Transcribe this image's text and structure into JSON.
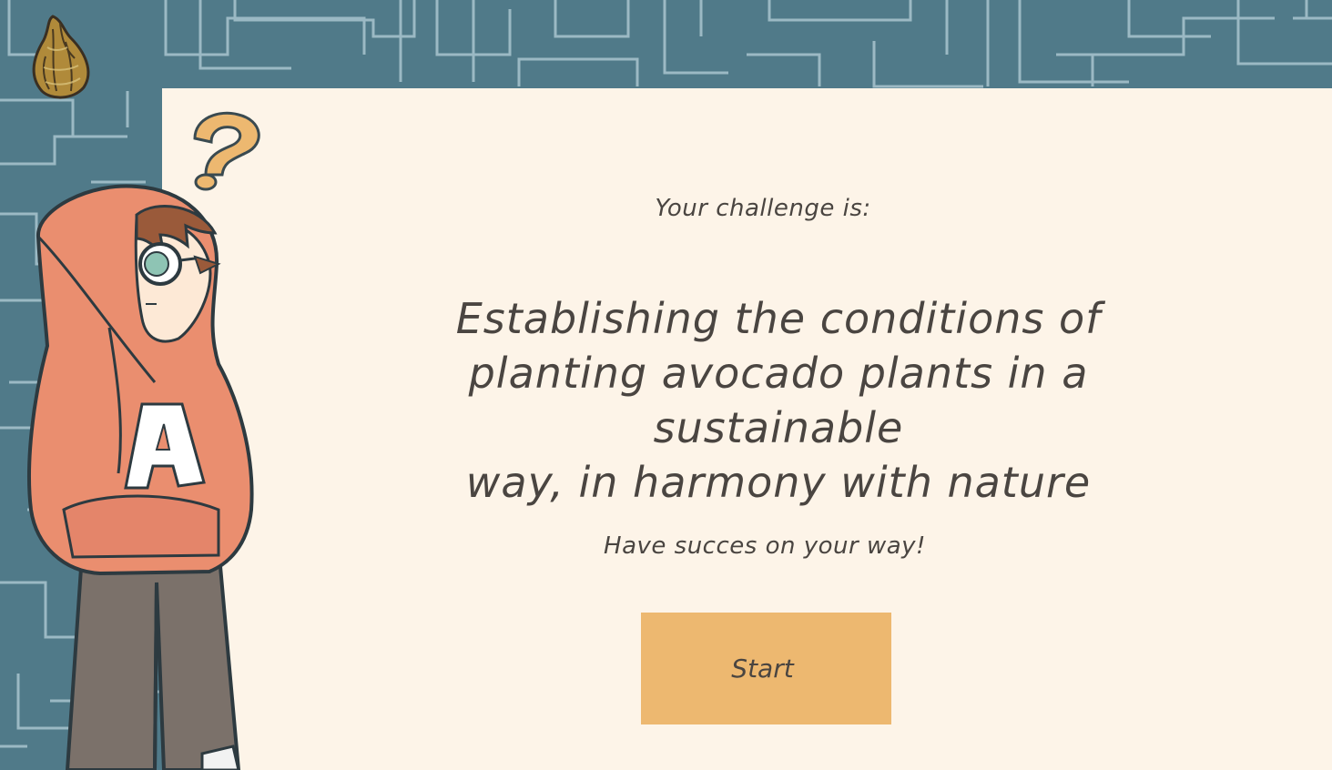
{
  "intro": {
    "text": "Your challenge is:"
  },
  "challenge": {
    "lines": [
      "Establishing the conditions of",
      "planting avocado plants in a sustainable",
      "way, in harmony with nature"
    ]
  },
  "wish": {
    "text": "Have succes on your way!"
  },
  "start_button": {
    "label": "Start"
  },
  "character": {
    "hoodie_letter": "A"
  },
  "colors": {
    "background": "#507a89",
    "maze_lines": "#a9c4cf",
    "panel": "#fdf4e8",
    "button": "#edb870",
    "hoodie": "#ea8e6f",
    "text": "#4a4541"
  }
}
